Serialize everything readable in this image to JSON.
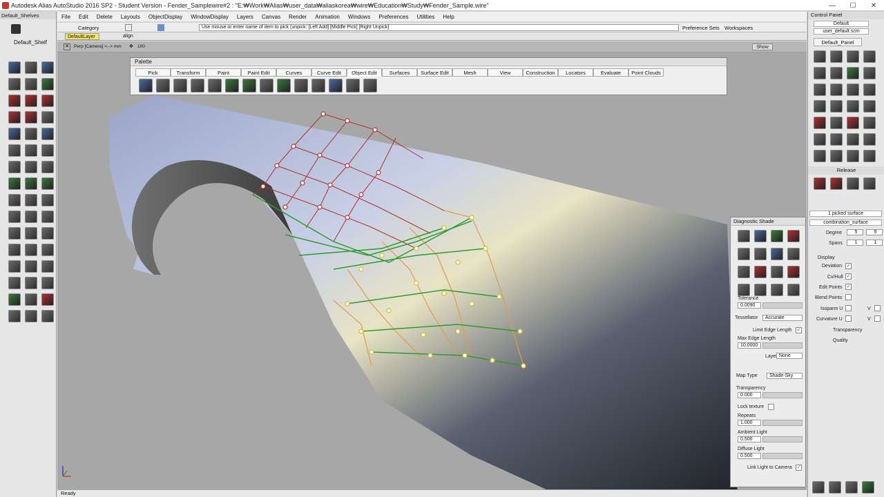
{
  "window": {
    "title": "Autodesk Alias AutoStudio 2016 SP2 - Student Version    - Fender_Samplewire#2 : \"E:₩Work₩Alias₩user_data₩aliaskorea₩wire₩Education₩Study₩Fender_Sample.wire\""
  },
  "menu": [
    "File",
    "Edit",
    "Delete",
    "Layouts",
    "ObjectDisplay",
    "WindowDisplay",
    "Layers",
    "Canvas",
    "Render",
    "Animation",
    "Windows",
    "Preferences",
    "Utilities",
    "Help"
  ],
  "shelf": {
    "title": "Default_Shelves",
    "name": "Default_Shelf"
  },
  "category": {
    "label": "Category",
    "layer": "DefaultLayer",
    "align": "align"
  },
  "prompt": "Use mouse or enter name of item to pick (unpick: [Left Add] [Middle Pick] [Right Unpick]",
  "prefsets": "Preference Sets",
  "workspaces": "Workspaces",
  "viewport": {
    "camera": "Perp [Camera] <--> mm",
    "zoom": "100",
    "show": "Show"
  },
  "palette": {
    "title": "Palette",
    "tabs": [
      "Pick",
      "Transform",
      "Paint",
      "Paint Edit",
      "Curves",
      "Curve Edit",
      "Object Edit",
      "Surfaces",
      "Surface Edit",
      "Mesh",
      "View",
      "Construction",
      "Locators",
      "Evaluate",
      "Point Clouds"
    ],
    "active_tab": "Object Edit"
  },
  "diagnostic": {
    "title": "Diagnostic Shade",
    "tolerance_label": "Tolerance",
    "tolerance": "0.0090",
    "tessellator_label": "Tessellator",
    "tessellator": "Accurate",
    "limit_edge": "Limit Edge Length",
    "max_edge_label": "Max Edge Length",
    "max_edge": "10.0000",
    "layer_label": "Layer",
    "layer": "None",
    "map_type_label": "Map Type",
    "map_type": "Shade-Sky",
    "transparency_label": "Transparency",
    "transparency": "0.000",
    "lock_texture": "Lock texture",
    "repeats_label": "Repeats",
    "repeats": "1.000",
    "ambient_label": "Ambient Light",
    "ambient": "0.500",
    "diffuse_label": "Diffuse Light",
    "diffuse": "0.500",
    "link_light": "Link Light to Camera"
  },
  "control_panel": {
    "title": "Control Panel",
    "default": "Default",
    "scm": "user_default.scm",
    "tab": "Default_Panel",
    "release": "Release",
    "picked": "1 picked surface",
    "name": "combination_surface",
    "degree_label": "Degree",
    "degree_u": "5",
    "degree_v": "5",
    "spans_label": "Spans",
    "spans_u": "1",
    "spans_v": "1",
    "display": "Display",
    "deviation": "Deviation",
    "cvhull": "Cv/Hull",
    "edit_points": "Edit Points",
    "blend_points": "Blend Points",
    "isoparm": "Isoparm U",
    "isoparm_v": "V",
    "curvature": "Curvature U",
    "curvature_v": "V",
    "transparency": "Transparency",
    "quality": "Quality"
  },
  "status": "Ready"
}
